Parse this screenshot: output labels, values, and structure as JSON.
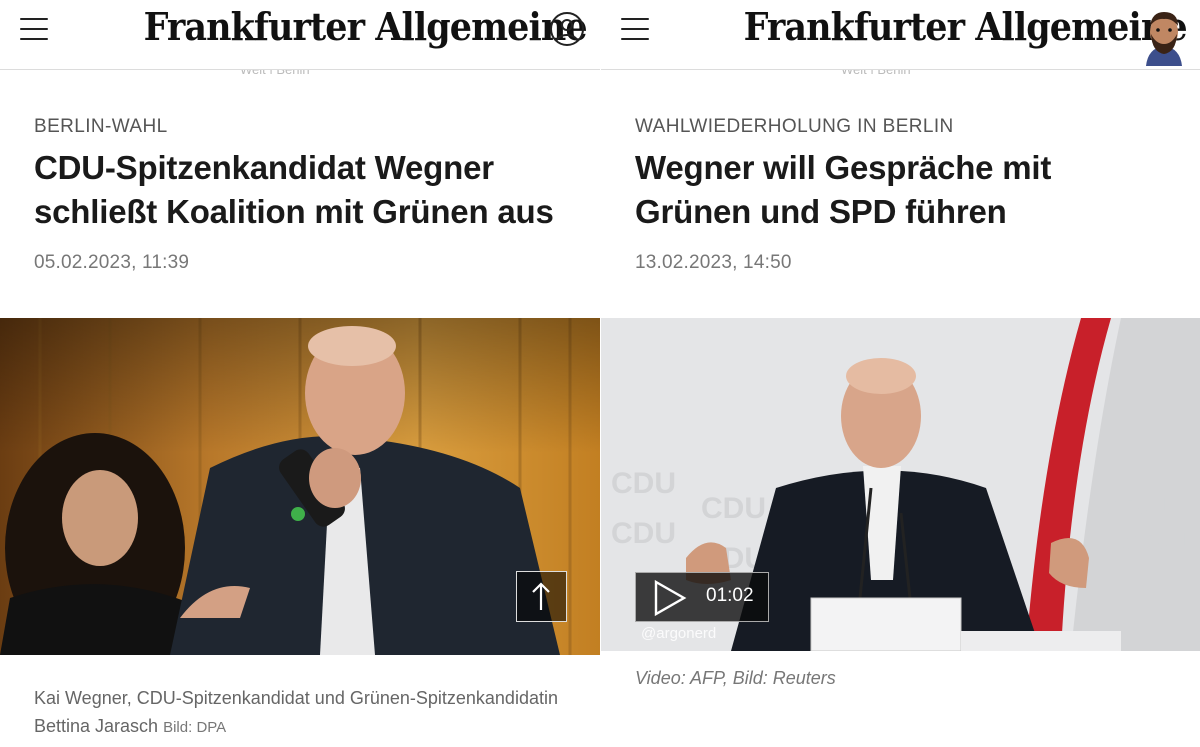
{
  "header": {
    "logo_text": "Frankfurter Allgemeine",
    "ghost_text": "Welt | Berlin"
  },
  "left_article": {
    "kicker": "BERLIN-WAHL",
    "headline": "CDU-Spitzenkandidat Wegner schließt Koalition mit Grünen aus",
    "date": "05.02.2023, 11:39",
    "caption_text": "Kai Wegner, CDU-Spitzenkandidat und Grünen-Spitzenkandidatin Bettina Jarasch",
    "caption_credit": "Bild: DPA",
    "scroll_top_icon": "arrow-up-icon"
  },
  "right_article": {
    "kicker": "WAHLWIEDERHOLUNG IN BERLIN",
    "headline": "Wegner will Gespräche mit Grünen und SPD führen",
    "date": "13.02.2023, 14:50",
    "video_duration": "01:02",
    "watermark": "@argonerd",
    "caption": "Video: AFP, Bild: Reuters",
    "backdrop_text": "CDU"
  },
  "colors": {
    "accent_red": "#c8202a",
    "stage_amber": "#c98c2c",
    "text_dark": "#1a1a1a",
    "text_muted": "#777777"
  }
}
